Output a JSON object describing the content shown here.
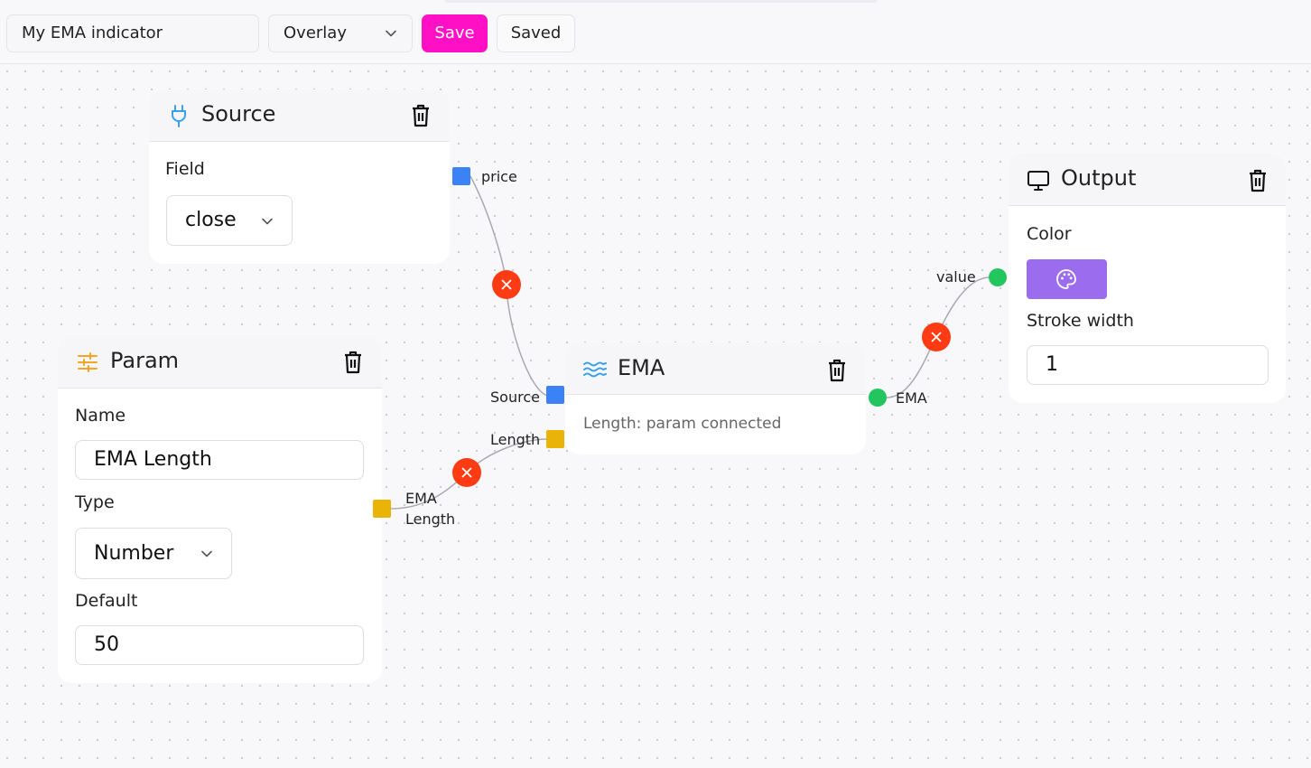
{
  "toolbar": {
    "indicator_name": "My EMA indicator",
    "mode_value": "Overlay",
    "save_label": "Save",
    "status_label": "Saved"
  },
  "nodes": {
    "source": {
      "title": "Source",
      "field_label": "Field",
      "field_value": "close",
      "output_label": "price"
    },
    "param": {
      "title": "Param",
      "name_label": "Name",
      "name_value": "EMA Length",
      "type_label": "Type",
      "type_value": "Number",
      "default_label": "Default",
      "default_value": "50",
      "output_label_line1": "EMA",
      "output_label_line2": "Length"
    },
    "ema": {
      "title": "EMA",
      "source_label": "Source",
      "length_label": "Length",
      "output_label": "EMA",
      "description": "Length: param connected"
    },
    "output": {
      "title": "Output",
      "color_label": "Color",
      "stroke_label": "Stroke width",
      "stroke_value": "1",
      "input_label": "value",
      "color_value": "#9b6dee"
    }
  },
  "colors": {
    "accent": "#ff10c4",
    "handle_blue": "#3b82f6",
    "handle_yellow": "#eab308",
    "handle_green": "#22c55e",
    "edge_delete": "#ff3b14"
  }
}
